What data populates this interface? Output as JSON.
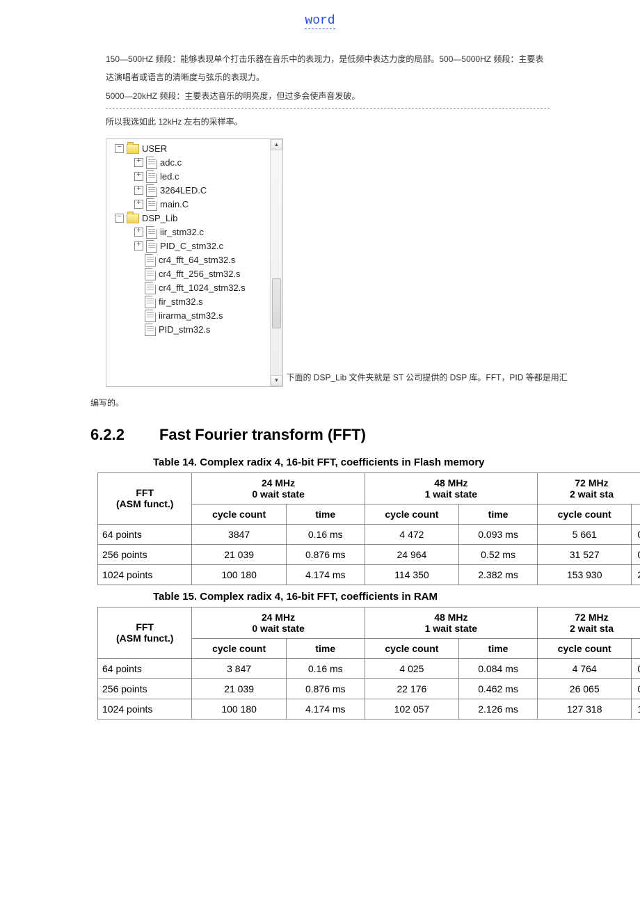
{
  "header": {
    "title": "word"
  },
  "para": {
    "p1": "150—500HZ 频段：能够表现单个打击乐器在音乐中的表现力，是低频中表达力度的局部。500—5000HZ 频段：主要表达演唱者或语言的清晰度与弦乐的表现力。",
    "p2": "5000—20kHZ 频段：主要表达音乐的明亮度，但过多会使声音发破。",
    "p3": " 所以我选如此 12kHz 左右的采样率。"
  },
  "tree": {
    "items": [
      {
        "lvl": 1,
        "exp": "−",
        "icon": "folder",
        "label": "USER"
      },
      {
        "lvl": 2,
        "exp": "+",
        "icon": "file",
        "label": "adc.c"
      },
      {
        "lvl": 2,
        "exp": "+",
        "icon": "file",
        "label": "led.c"
      },
      {
        "lvl": 2,
        "exp": "+",
        "icon": "file",
        "label": "3264LED.C"
      },
      {
        "lvl": 2,
        "exp": "+",
        "icon": "file",
        "label": "main.C"
      },
      {
        "lvl": 1,
        "exp": "−",
        "icon": "folder",
        "label": "DSP_Lib"
      },
      {
        "lvl": 2,
        "exp": "+",
        "icon": "file",
        "label": "iir_stm32.c"
      },
      {
        "lvl": 2,
        "exp": "+",
        "icon": "file",
        "label": "PID_C_stm32.c"
      },
      {
        "lvl": 2,
        "exp": "",
        "icon": "file",
        "label": "cr4_fft_64_stm32.s"
      },
      {
        "lvl": 2,
        "exp": "",
        "icon": "file",
        "label": "cr4_fft_256_stm32.s"
      },
      {
        "lvl": 2,
        "exp": "",
        "icon": "file",
        "label": "cr4_fft_1024_stm32.s"
      },
      {
        "lvl": 2,
        "exp": "",
        "icon": "file",
        "label": "fir_stm32.s"
      },
      {
        "lvl": 2,
        "exp": "",
        "icon": "file",
        "label": "iirarma_stm32.s"
      },
      {
        "lvl": 2,
        "exp": "",
        "icon": "file",
        "label": "PID_stm32.s"
      }
    ]
  },
  "note_inline": "下面的 DSP_Lib 文件夹就是 ST 公司提供的 DSP 库。FFT，PID 等都是用汇",
  "note_below": "编写的。",
  "section": {
    "num": "6.2.2",
    "title": "Fast Fourier transform (FFT)"
  },
  "tbl14": {
    "title": "Table 14.    Complex radix 4, 16-bit FFT, coefficients in Flash memory",
    "h1": [
      "FFT\n(ASM funct.)",
      "24 MHz\n0 wait state",
      "48 MHz\n1 wait state",
      "72 MHz\n2 wait sta"
    ],
    "h2": [
      "cycle count",
      "time",
      "cycle count",
      "time",
      "cycle count",
      ""
    ],
    "rows": [
      [
        "64 points",
        "3847",
        "0.16 ms",
        "4 472",
        "0.093 ms",
        "5 661",
        "0"
      ],
      [
        "256 points",
        "21 039",
        "0.876 ms",
        "24 964",
        "0.52 ms",
        "31 527",
        "0"
      ],
      [
        "1024 points",
        "100 180",
        "4.174 ms",
        "114 350",
        "2.382 ms",
        "153 930",
        "2"
      ]
    ]
  },
  "tbl15": {
    "title": "Table 15.    Complex radix 4, 16-bit FFT, coefficients in RAM",
    "h1": [
      "FFT\n(ASM funct.)",
      "24 MHz\n0 wait state",
      "48 MHz\n1 wait state",
      "72 MHz\n2 wait sta"
    ],
    "h2": [
      "cycle count",
      "time",
      "cycle count",
      "time",
      "cycle count",
      ""
    ],
    "rows": [
      [
        "64 points",
        "3 847",
        "0.16 ms",
        "4 025",
        "0.084 ms",
        "4 764",
        "0"
      ],
      [
        "256 points",
        "21 039",
        "0.876 ms",
        "22 176",
        "0.462 ms",
        "26 065",
        "0"
      ],
      [
        "1024 points",
        "100 180",
        "4.174 ms",
        "102 057",
        "2.126 ms",
        "127 318",
        "1"
      ]
    ]
  }
}
